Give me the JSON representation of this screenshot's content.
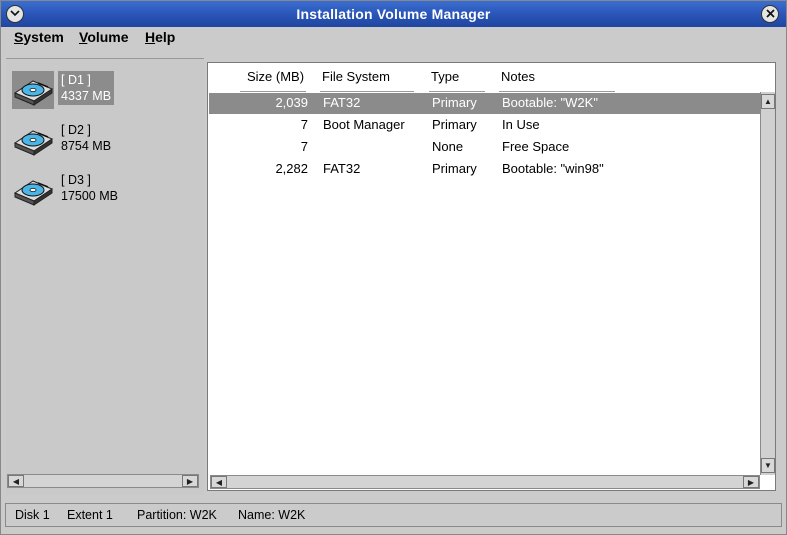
{
  "window": {
    "title": "Installation Volume Manager"
  },
  "menubar": {
    "system": {
      "first": "S",
      "rest": "ystem"
    },
    "volume": {
      "first": "V",
      "rest": "olume"
    },
    "help": {
      "first": "H",
      "rest": "elp"
    }
  },
  "disks": [
    {
      "name": "[ D1 ]",
      "size": "4337 MB",
      "selected": true
    },
    {
      "name": "[ D2 ]",
      "size": "8754 MB",
      "selected": false
    },
    {
      "name": "[ D3 ]",
      "size": "17500 MB",
      "selected": false
    }
  ],
  "partitions": {
    "headers": {
      "size": "Size (MB)",
      "fs": "File System",
      "type": "Type",
      "notes": "Notes"
    },
    "rows": [
      {
        "size": "2,039",
        "fs": "FAT32",
        "type": "Primary",
        "notes": "Bootable:  \"W2K\"",
        "selected": true
      },
      {
        "size": "7",
        "fs": "Boot Manager",
        "type": "Primary",
        "notes": "In Use",
        "selected": false
      },
      {
        "size": "7",
        "fs": "",
        "type": "None",
        "notes": "Free Space",
        "selected": false
      },
      {
        "size": "2,282",
        "fs": "FAT32",
        "type": "Primary",
        "notes": "Bootable:  \"win98\"",
        "selected": false
      }
    ]
  },
  "status": {
    "disk": "Disk  1",
    "extent": "Extent  1",
    "partition": "Partition:  W2K",
    "name": "Name:  W2K"
  },
  "icons": {
    "window_menu": "chevron-down-icon",
    "close": "close-icon",
    "disk": "disk-drive-icon"
  },
  "colors": {
    "titlebar": "#2a56b8",
    "selection": "#8b8b8b",
    "background": "#cbcbcb"
  }
}
